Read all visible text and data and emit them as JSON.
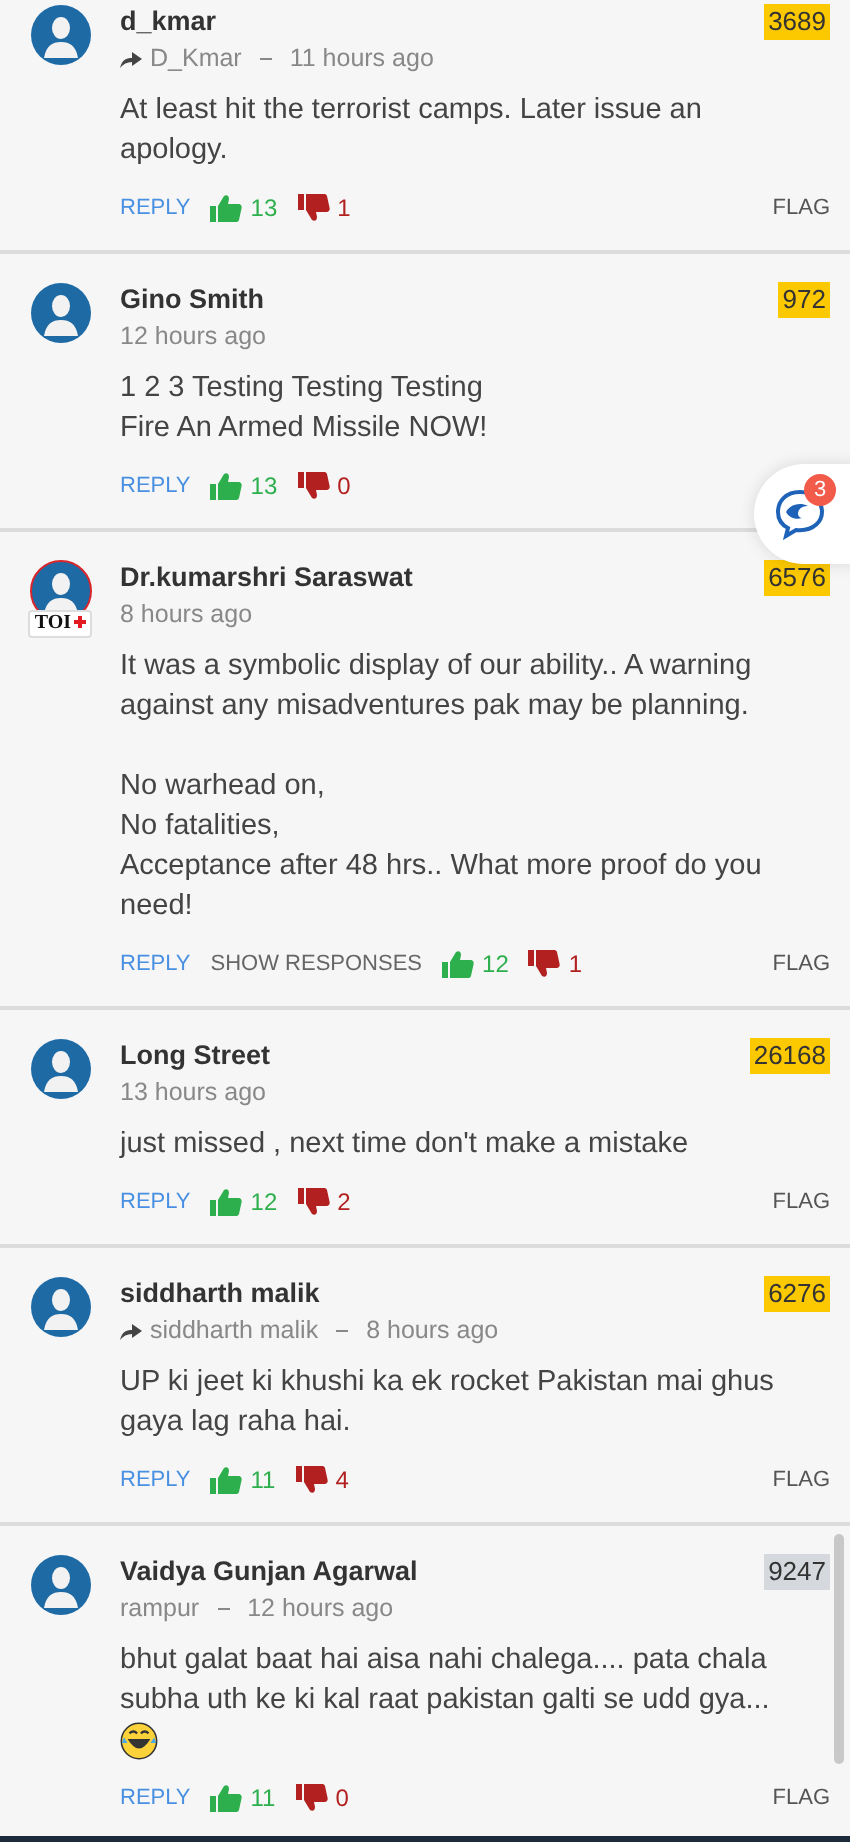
{
  "comments": [
    {
      "name": "d_kmar",
      "via": "D_Kmar",
      "time": "11 hours ago",
      "text": "At least hit the terrorist camps. Later issue an apology.",
      "score": {
        "text": "3689",
        "color": "#fcc800"
      },
      "reply": "REPLY",
      "likes": "13",
      "dislikes": "1",
      "flag": "FLAG"
    },
    {
      "name": "Gino Smith",
      "time": "12 hours ago",
      "text": "1 2 3 Testing Testing Testing\nFire An Armed Missile NOW!",
      "score": {
        "text": "972",
        "color": "#fcc800"
      },
      "reply": "REPLY",
      "likes": "13",
      "dislikes": "0"
    },
    {
      "name": "Dr.kumarshri Saraswat",
      "time": "8 hours ago",
      "text": "It was a symbolic display of our ability.. A warning against any misadventures pak may be planning.\n\nNo warhead on,\nNo fatalities,\nAcceptance after 48 hrs.. What more proof do you need!",
      "score": {
        "text": "6576",
        "color": "#fcc800"
      },
      "toi_text": "TOI",
      "reply": "REPLY",
      "show_responses": "SHOW RESPONSES",
      "likes": "12",
      "dislikes": "1",
      "flag": "FLAG"
    },
    {
      "name": "Long Street",
      "time": "13 hours ago",
      "text": "just missed , next time don't make a mistake",
      "score": {
        "text": "26168",
        "color": "#fcc800"
      },
      "reply": "REPLY",
      "likes": "12",
      "dislikes": "2",
      "flag": "FLAG"
    },
    {
      "name": "siddharth malik",
      "via": "siddharth malik",
      "time": "8 hours ago",
      "text": "UP ki jeet ki khushi ka ek rocket Pakistan mai ghus gaya lag raha hai.",
      "score": {
        "text": "6276",
        "color": "#fcc800"
      },
      "reply": "REPLY",
      "likes": "11",
      "dislikes": "4",
      "flag": "FLAG"
    },
    {
      "name": "Vaidya Gunjan Agarwal",
      "location": "rampur",
      "time": "12 hours ago",
      "text": "bhut galat baat hai aisa nahi chalega.... pata chala subha uth ke ki kal raat pakistan galti se udd gya...",
      "emoji": true,
      "score": {
        "text": "9247",
        "color": "#d5d9dd"
      },
      "reply": "REPLY",
      "likes": "11",
      "dislikes": "0",
      "flag": "FLAG"
    }
  ],
  "chat": {
    "count": "3"
  }
}
